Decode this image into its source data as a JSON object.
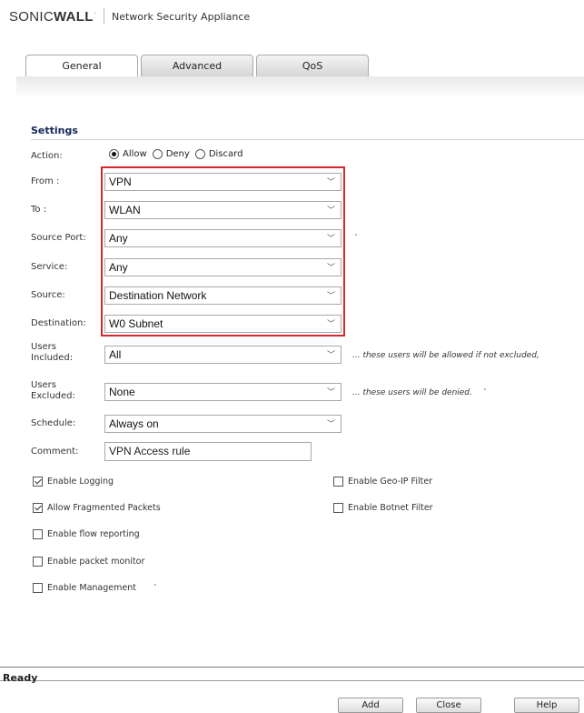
{
  "header": {
    "logo": "SONICWALL",
    "product": "Network Security Appliance"
  },
  "tabs": [
    "General",
    "Advanced",
    "QoS"
  ],
  "section": "Settings",
  "action": {
    "label": "Action:",
    "options": [
      "Allow",
      "Deny",
      "Discard"
    ],
    "selected": "Allow"
  },
  "fields": {
    "from": {
      "label": "From :",
      "value": "VPN"
    },
    "to": {
      "label": "To :",
      "value": "WLAN"
    },
    "source_port": {
      "label": "Source Port:",
      "value": "Any"
    },
    "service": {
      "label": "Service:",
      "value": "Any"
    },
    "source": {
      "label": "Source:",
      "value": "Destination Network"
    },
    "destination": {
      "label": "Destination:",
      "value": "W0 Subnet"
    },
    "users_included": {
      "label_1": "Users",
      "label_2": "Included:",
      "value": "All",
      "note": "... these users will be allowed if not excluded,"
    },
    "users_excluded": {
      "label_1": "Users",
      "label_2": "Excluded:",
      "value": "None",
      "note": "... these users will be denied."
    },
    "schedule": {
      "label": "Schedule:",
      "value": "Always on"
    },
    "comment": {
      "label": "Comment:",
      "value": "VPN Access rule"
    }
  },
  "checkboxes": {
    "logging": {
      "label": "Enable Logging",
      "checked": true
    },
    "fragmented": {
      "label": "Allow Fragmented Packets",
      "checked": true
    },
    "flow": {
      "label": "Enable flow reporting",
      "checked": false
    },
    "packet_monitor": {
      "label": "Enable packet monitor",
      "checked": false
    },
    "management": {
      "label": "Enable Management",
      "checked": false
    },
    "geo_ip": {
      "label": "Enable Geo-IP Filter",
      "checked": false
    },
    "botnet": {
      "label": "Enable Botnet Filter",
      "checked": false
    }
  },
  "status": "Ready",
  "buttons": {
    "add": "Add",
    "close": "Close",
    "help": "Help"
  },
  "colors": {
    "highlight_border": "#d6282f",
    "heading": "#14265a"
  }
}
